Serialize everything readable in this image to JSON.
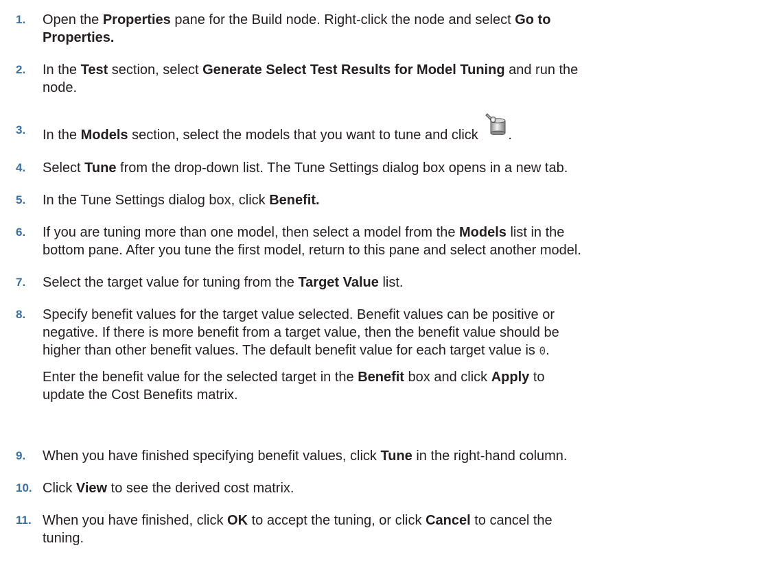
{
  "steps": [
    {
      "number": "1.",
      "parts": {
        "a": "Open the ",
        "b": "Properties",
        "c": " pane for the Build node. Right-click the node and select ",
        "d": "Go to",
        "e": "Properties."
      }
    },
    {
      "number": "2.",
      "parts": {
        "a": "In the ",
        "b": "Test",
        "c": " section, select ",
        "d": "Generate Select Test Results for Model Tuning",
        "e": " and run the",
        "f": "node."
      }
    },
    {
      "number": "3.",
      "parts": {
        "a": "In the ",
        "b": "Models",
        "c": " section, select the models that you want to tune and click ",
        "d": "."
      },
      "icon": "model-tools-icon"
    },
    {
      "number": "4.",
      "parts": {
        "a": "Select ",
        "b": "Tune",
        "c": " from the drop-down list. The Tune Settings dialog box opens in a new tab."
      }
    },
    {
      "number": "5.",
      "parts": {
        "a": "In the Tune Settings dialog box, click ",
        "b": "Benefit."
      }
    },
    {
      "number": "6.",
      "parts": {
        "a": "If you are tuning more than one model, then select a model from the ",
        "b": "Models",
        "c": " list in the",
        "d": "bottom pane. After you tune the first model, return to this pane and select another model."
      }
    },
    {
      "number": "7.",
      "parts": {
        "a": "Select the target value for tuning from the ",
        "b": "Target Value",
        "c": " list."
      }
    },
    {
      "number": "8.",
      "parts": {
        "a": "Specify benefit values for the target value selected. Benefit values can be positive or",
        "b": "negative. If there is more benefit from a target value, then the benefit value should be",
        "c": "higher than other benefit values. The default benefit value for each target value is ",
        "d": "0",
        "e": "."
      },
      "sub": {
        "a": "Enter the benefit value for the selected target in the ",
        "b": "Benefit",
        "c": " box and click ",
        "d": "Apply",
        "e": " to",
        "f": "update the Cost Benefits matrix."
      }
    },
    {
      "number": "9.",
      "parts": {
        "a": "When you have finished specifying benefit values, click ",
        "b": "Tune",
        "c": " in the right-hand column."
      }
    },
    {
      "number": "10.",
      "parts": {
        "a": "Click ",
        "b": "View",
        "c": " to see the derived cost matrix."
      }
    },
    {
      "number": "11.",
      "parts": {
        "a": "When you have finished, click ",
        "b": "OK",
        "c": " to accept the tuning, or click ",
        "d": "Cancel",
        "e": " to cancel the",
        "f": "tuning."
      }
    }
  ]
}
